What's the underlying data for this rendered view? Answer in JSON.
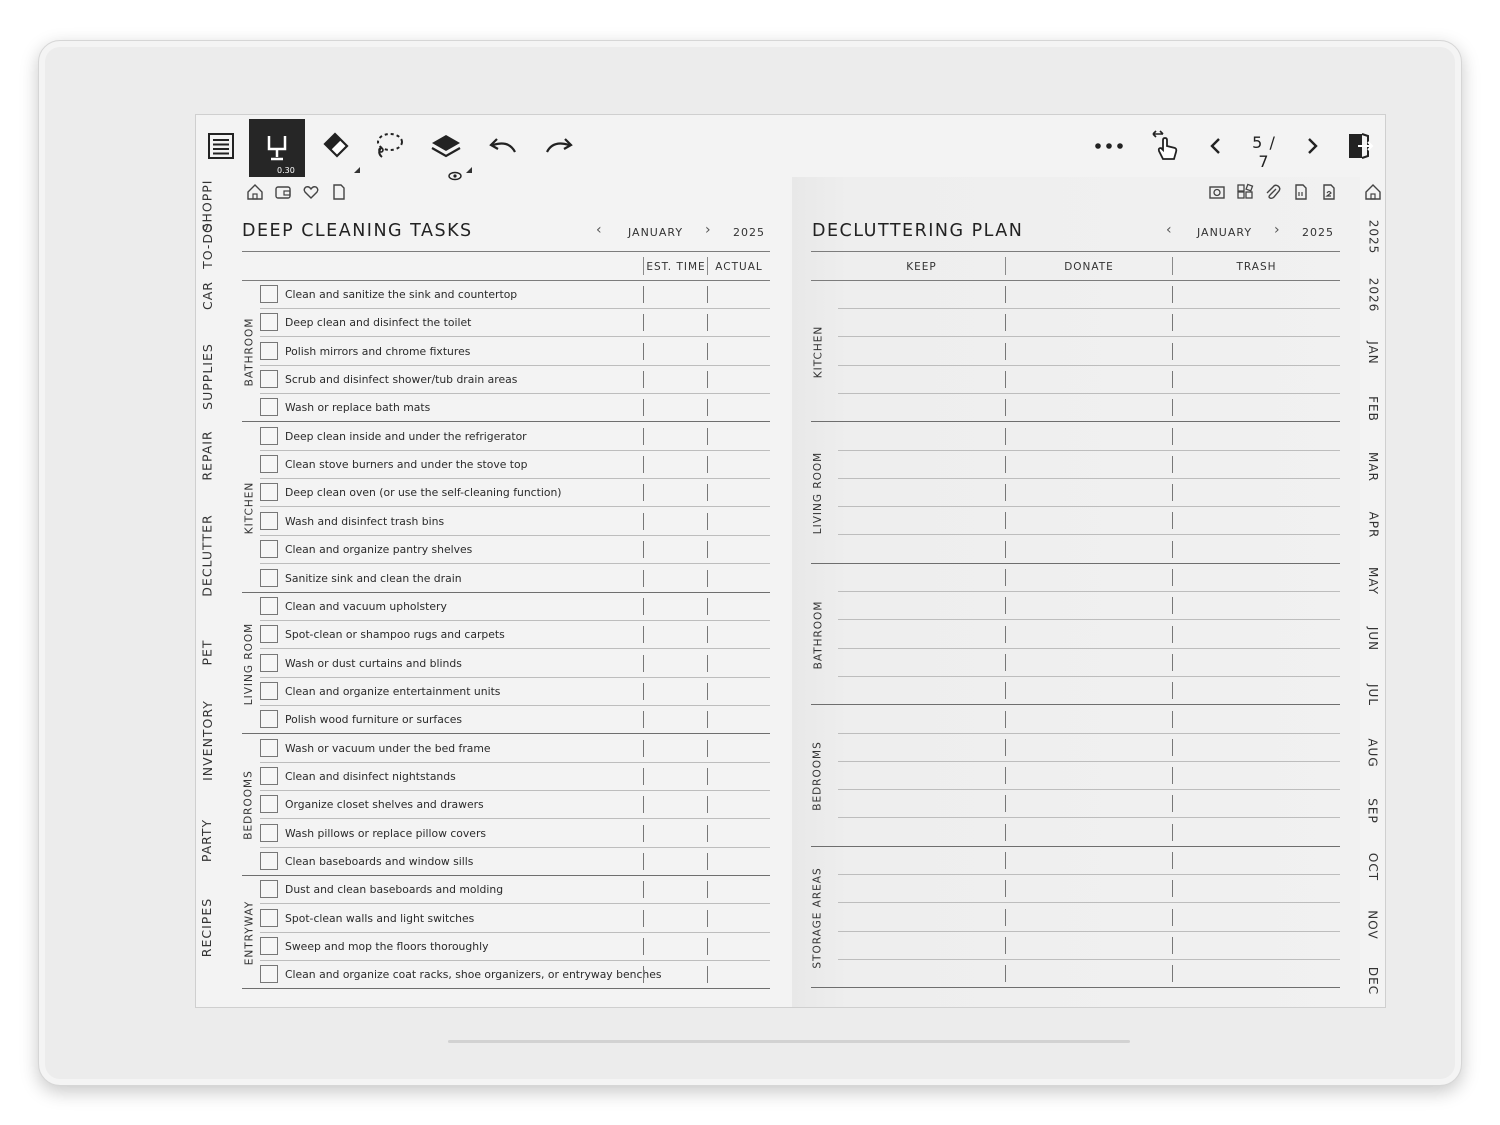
{
  "toolbar": {
    "pen_size": "0.30",
    "page_indicator": "5 / 7"
  },
  "left_tabs": [
    "TO-DO",
    "SHOPPI",
    "CAR",
    "SUPPLIES",
    "REPAIR",
    "DECLUTTER",
    "PET",
    "INVENTORY",
    "PARTY",
    "RECIPES"
  ],
  "right_tabs": [
    "2025",
    "2026",
    "JAN",
    "FEB",
    "MAR",
    "APR",
    "MAY",
    "JUN",
    "JUL",
    "AUG",
    "SEP",
    "OCT",
    "NOV",
    "DEC"
  ],
  "deep_cleaning": {
    "title": "DEEP CLEANING TASKS",
    "month": "JANUARY",
    "year": "2025",
    "col_est": "EST. TIME",
    "col_actual": "ACTUAL",
    "groups": [
      {
        "name": "BATHROOM",
        "tasks": [
          "Clean and sanitize the sink and countertop",
          "Deep clean and disinfect the toilet",
          "Polish mirrors and chrome fixtures",
          "Scrub and disinfect shower/tub drain areas",
          "Wash or replace bath mats"
        ]
      },
      {
        "name": "KITCHEN",
        "tasks": [
          "Deep clean inside and under the refrigerator",
          "Clean stove burners and under the stove top",
          "Deep clean oven (or use the self-cleaning function)",
          "Wash and disinfect trash bins",
          "Clean and organize pantry shelves",
          "Sanitize sink and clean the drain"
        ]
      },
      {
        "name": "LIVING ROOM",
        "tasks": [
          "Clean and vacuum upholstery",
          "Spot-clean or shampoo rugs and carpets",
          "Wash or dust curtains and blinds",
          "Clean and organize entertainment units",
          "Polish wood furniture or surfaces"
        ]
      },
      {
        "name": "BEDROOMS",
        "tasks": [
          "Wash or vacuum under the bed frame",
          "Clean and disinfect nightstands",
          "Organize closet shelves and drawers",
          "Wash pillows or replace pillow covers",
          "Clean baseboards and window sills"
        ]
      },
      {
        "name": "ENTRYWAY",
        "tasks": [
          "Dust and clean baseboards and molding",
          "Spot-clean walls and light switches",
          "Sweep and mop the floors thoroughly",
          "Clean and organize coat racks, shoe organizers, or entryway benches"
        ]
      }
    ]
  },
  "decluttering": {
    "title": "DECLUTTERING PLAN",
    "month": "JANUARY",
    "year": "2025",
    "col_keep": "KEEP",
    "col_donate": "DONATE",
    "col_trash": "TRASH",
    "sections": [
      "KITCHEN",
      "LIVING ROOM",
      "BATHROOM",
      "BEDROOMS",
      "STORAGE AREAS"
    ]
  }
}
